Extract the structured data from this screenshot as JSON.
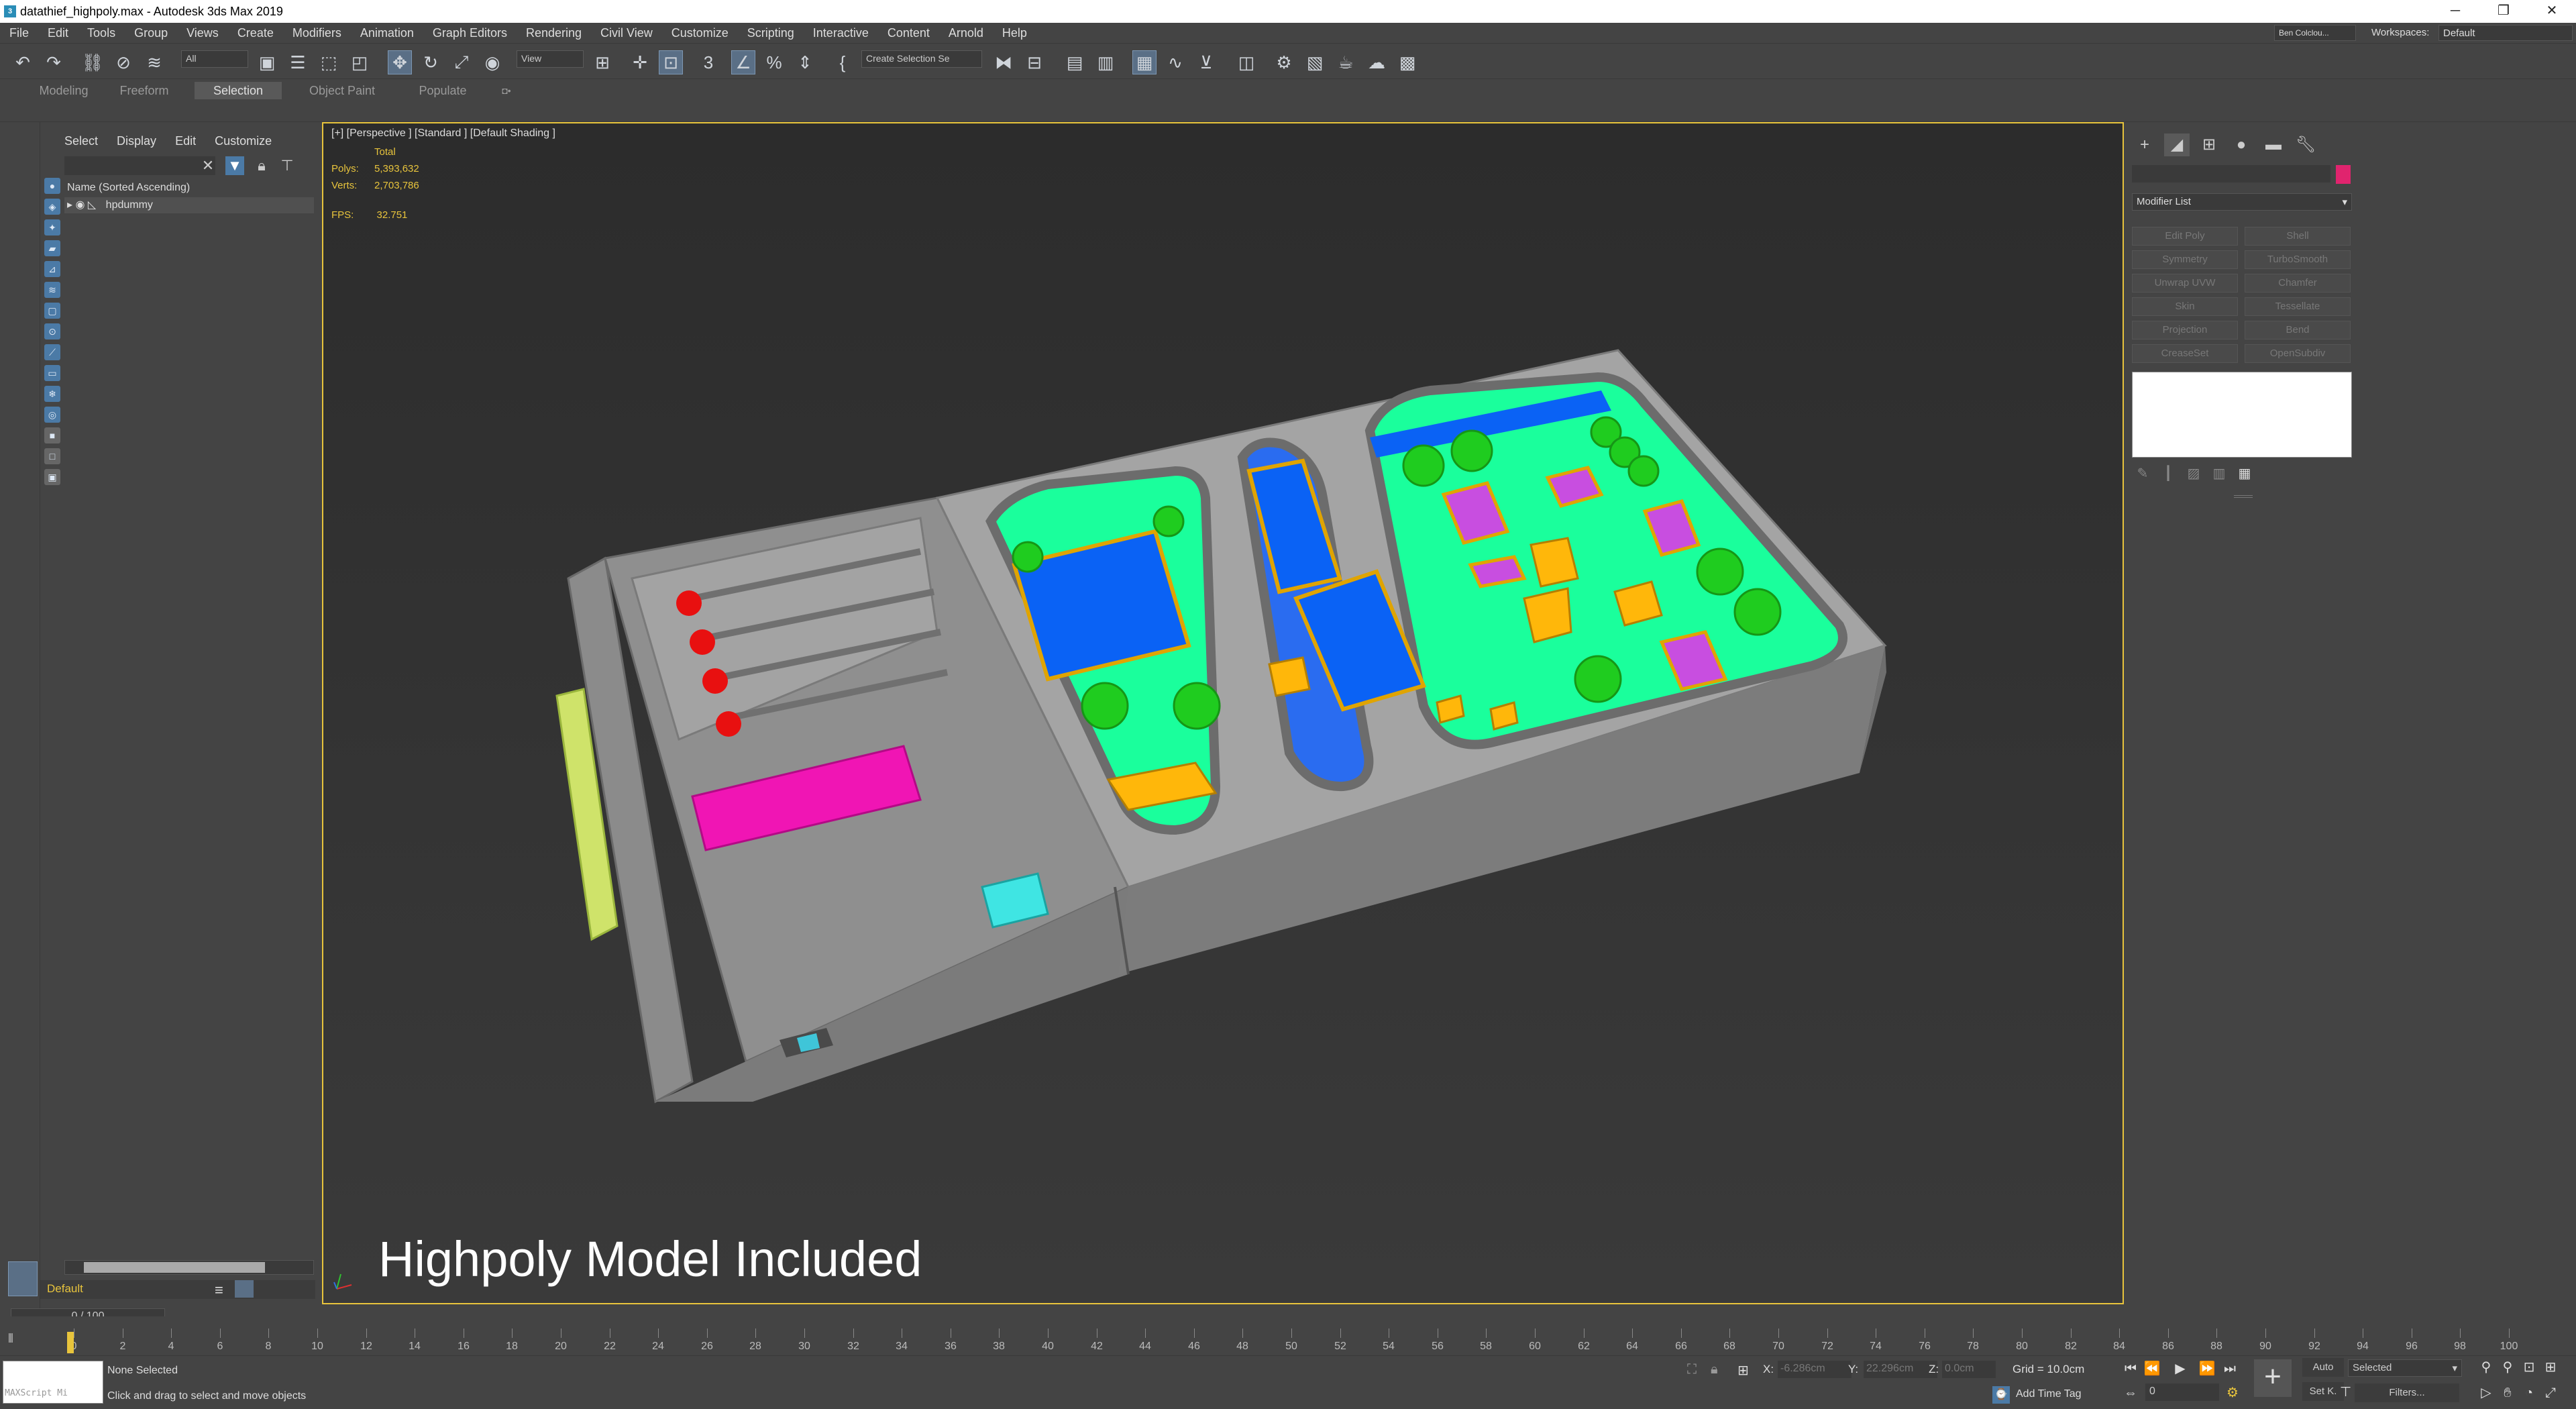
{
  "titlebar": {
    "title": "datathief_highpoly.max - Autodesk 3ds Max 2019",
    "minimize": "─",
    "restore": "❐",
    "close": "✕"
  },
  "menu": {
    "items": [
      "File",
      "Edit",
      "Tools",
      "Group",
      "Views",
      "Create",
      "Modifiers",
      "Animation",
      "Graph Editors",
      "Rendering",
      "Civil View",
      "Customize",
      "Scripting",
      "Interactive",
      "Content",
      "Arnold",
      "Help"
    ],
    "user": "Ben Colclou...",
    "workspaces_label": "Workspaces:",
    "workspace": "Default"
  },
  "toolbar": {
    "selection_filter": "All",
    "ref_coord": "View",
    "selection_set": "Create Selection Se"
  },
  "ribbon": {
    "tabs": [
      "Modeling",
      "Freeform",
      "Selection",
      "Object Paint",
      "Populate"
    ],
    "active": "Selection"
  },
  "explorer": {
    "tabs": [
      "Select",
      "Display",
      "Edit",
      "Customize"
    ],
    "column_header": "Name (Sorted Ascending)",
    "rows": [
      {
        "name": "hpdummy"
      }
    ],
    "layer": "Default"
  },
  "viewport": {
    "label": "[+] [Perspective ] [Standard ] [Default Shading ]",
    "stats_header": "Total",
    "polys_label": "Polys:",
    "polys": "5,393,632",
    "verts_label": "Verts:",
    "verts": "2,703,786",
    "fps_label": "FPS:",
    "fps": "32.751",
    "caption": "Highpoly Model Included"
  },
  "command_panel": {
    "modifier_list": "Modifier List",
    "modifiers": [
      "Edit Poly",
      "Shell",
      "Symmetry",
      "TurboSmooth",
      "Unwrap UVW",
      "Chamfer",
      "Skin",
      "Tessellate",
      "Projection",
      "Bend",
      "CreaseSet",
      "OpenSubdiv"
    ],
    "object_color": "#e0246e"
  },
  "timeline": {
    "frame_counter": "0 / 100",
    "ticks": [
      0,
      2,
      4,
      6,
      8,
      10,
      12,
      14,
      16,
      18,
      20,
      22,
      24,
      26,
      28,
      30,
      32,
      34,
      36,
      38,
      40,
      42,
      44,
      46,
      48,
      50,
      52,
      54,
      56,
      58,
      60,
      62,
      64,
      66,
      68,
      70,
      72,
      74,
      76,
      78,
      80,
      82,
      84,
      86,
      88,
      90,
      92,
      94,
      96,
      98,
      100
    ]
  },
  "status": {
    "maxscript": "MAXScript Mi",
    "selection": "None Selected",
    "prompt": "Click and drag to select and move objects",
    "x_label": "X:",
    "x": "-6.286cm",
    "y_label": "Y:",
    "y": "22.296cm",
    "z_label": "Z:",
    "z": "0.0cm",
    "grid": "Grid = 10.0cm",
    "add_time_tag": "Add Time Tag",
    "auto": "Auto",
    "set_key": "Set K.",
    "key_filter": "Selected",
    "filters": "Filters...",
    "frame": "0"
  }
}
